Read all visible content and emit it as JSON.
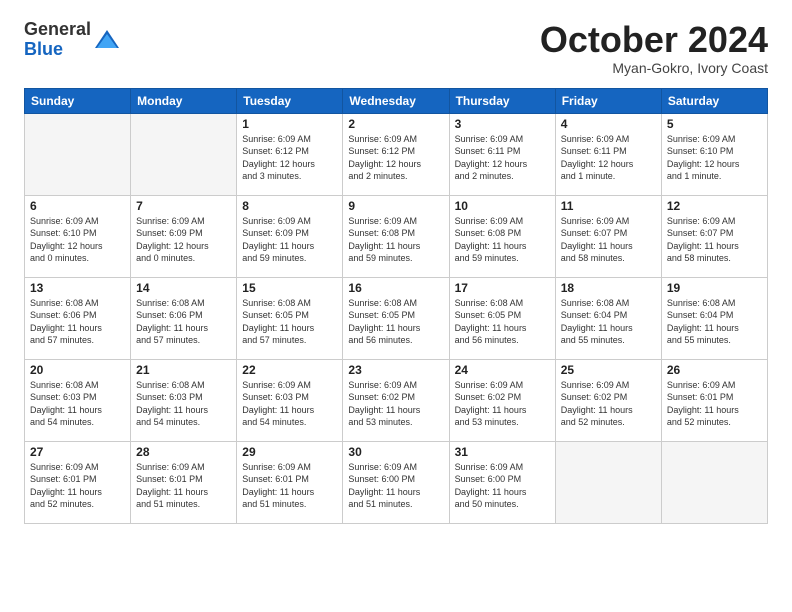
{
  "logo": {
    "general": "General",
    "blue": "Blue"
  },
  "title": "October 2024",
  "subtitle": "Myan-Gokro, Ivory Coast",
  "weekdays": [
    "Sunday",
    "Monday",
    "Tuesday",
    "Wednesday",
    "Thursday",
    "Friday",
    "Saturday"
  ],
  "weeks": [
    [
      {
        "day": "",
        "info": ""
      },
      {
        "day": "",
        "info": ""
      },
      {
        "day": "1",
        "info": "Sunrise: 6:09 AM\nSunset: 6:12 PM\nDaylight: 12 hours\nand 3 minutes."
      },
      {
        "day": "2",
        "info": "Sunrise: 6:09 AM\nSunset: 6:12 PM\nDaylight: 12 hours\nand 2 minutes."
      },
      {
        "day": "3",
        "info": "Sunrise: 6:09 AM\nSunset: 6:11 PM\nDaylight: 12 hours\nand 2 minutes."
      },
      {
        "day": "4",
        "info": "Sunrise: 6:09 AM\nSunset: 6:11 PM\nDaylight: 12 hours\nand 1 minute."
      },
      {
        "day": "5",
        "info": "Sunrise: 6:09 AM\nSunset: 6:10 PM\nDaylight: 12 hours\nand 1 minute."
      }
    ],
    [
      {
        "day": "6",
        "info": "Sunrise: 6:09 AM\nSunset: 6:10 PM\nDaylight: 12 hours\nand 0 minutes."
      },
      {
        "day": "7",
        "info": "Sunrise: 6:09 AM\nSunset: 6:09 PM\nDaylight: 12 hours\nand 0 minutes."
      },
      {
        "day": "8",
        "info": "Sunrise: 6:09 AM\nSunset: 6:09 PM\nDaylight: 11 hours\nand 59 minutes."
      },
      {
        "day": "9",
        "info": "Sunrise: 6:09 AM\nSunset: 6:08 PM\nDaylight: 11 hours\nand 59 minutes."
      },
      {
        "day": "10",
        "info": "Sunrise: 6:09 AM\nSunset: 6:08 PM\nDaylight: 11 hours\nand 59 minutes."
      },
      {
        "day": "11",
        "info": "Sunrise: 6:09 AM\nSunset: 6:07 PM\nDaylight: 11 hours\nand 58 minutes."
      },
      {
        "day": "12",
        "info": "Sunrise: 6:09 AM\nSunset: 6:07 PM\nDaylight: 11 hours\nand 58 minutes."
      }
    ],
    [
      {
        "day": "13",
        "info": "Sunrise: 6:08 AM\nSunset: 6:06 PM\nDaylight: 11 hours\nand 57 minutes."
      },
      {
        "day": "14",
        "info": "Sunrise: 6:08 AM\nSunset: 6:06 PM\nDaylight: 11 hours\nand 57 minutes."
      },
      {
        "day": "15",
        "info": "Sunrise: 6:08 AM\nSunset: 6:05 PM\nDaylight: 11 hours\nand 57 minutes."
      },
      {
        "day": "16",
        "info": "Sunrise: 6:08 AM\nSunset: 6:05 PM\nDaylight: 11 hours\nand 56 minutes."
      },
      {
        "day": "17",
        "info": "Sunrise: 6:08 AM\nSunset: 6:05 PM\nDaylight: 11 hours\nand 56 minutes."
      },
      {
        "day": "18",
        "info": "Sunrise: 6:08 AM\nSunset: 6:04 PM\nDaylight: 11 hours\nand 55 minutes."
      },
      {
        "day": "19",
        "info": "Sunrise: 6:08 AM\nSunset: 6:04 PM\nDaylight: 11 hours\nand 55 minutes."
      }
    ],
    [
      {
        "day": "20",
        "info": "Sunrise: 6:08 AM\nSunset: 6:03 PM\nDaylight: 11 hours\nand 54 minutes."
      },
      {
        "day": "21",
        "info": "Sunrise: 6:08 AM\nSunset: 6:03 PM\nDaylight: 11 hours\nand 54 minutes."
      },
      {
        "day": "22",
        "info": "Sunrise: 6:09 AM\nSunset: 6:03 PM\nDaylight: 11 hours\nand 54 minutes."
      },
      {
        "day": "23",
        "info": "Sunrise: 6:09 AM\nSunset: 6:02 PM\nDaylight: 11 hours\nand 53 minutes."
      },
      {
        "day": "24",
        "info": "Sunrise: 6:09 AM\nSunset: 6:02 PM\nDaylight: 11 hours\nand 53 minutes."
      },
      {
        "day": "25",
        "info": "Sunrise: 6:09 AM\nSunset: 6:02 PM\nDaylight: 11 hours\nand 52 minutes."
      },
      {
        "day": "26",
        "info": "Sunrise: 6:09 AM\nSunset: 6:01 PM\nDaylight: 11 hours\nand 52 minutes."
      }
    ],
    [
      {
        "day": "27",
        "info": "Sunrise: 6:09 AM\nSunset: 6:01 PM\nDaylight: 11 hours\nand 52 minutes."
      },
      {
        "day": "28",
        "info": "Sunrise: 6:09 AM\nSunset: 6:01 PM\nDaylight: 11 hours\nand 51 minutes."
      },
      {
        "day": "29",
        "info": "Sunrise: 6:09 AM\nSunset: 6:01 PM\nDaylight: 11 hours\nand 51 minutes."
      },
      {
        "day": "30",
        "info": "Sunrise: 6:09 AM\nSunset: 6:00 PM\nDaylight: 11 hours\nand 51 minutes."
      },
      {
        "day": "31",
        "info": "Sunrise: 6:09 AM\nSunset: 6:00 PM\nDaylight: 11 hours\nand 50 minutes."
      },
      {
        "day": "",
        "info": ""
      },
      {
        "day": "",
        "info": ""
      }
    ]
  ]
}
